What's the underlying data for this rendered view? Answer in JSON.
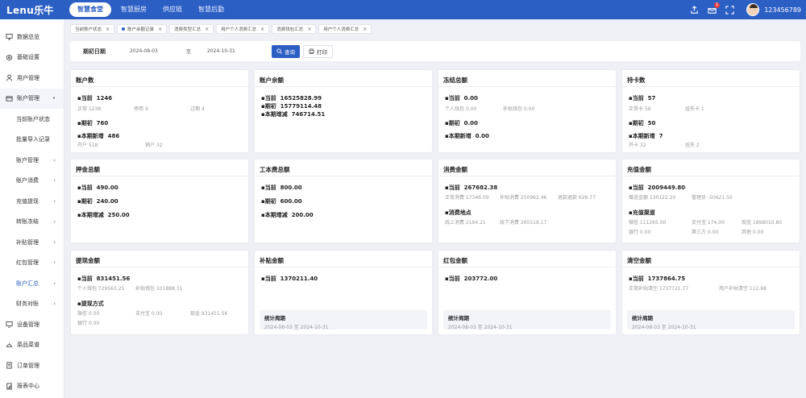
{
  "app": {
    "logo": "Lenu乐牛",
    "username": "123456789",
    "notification_count": "1"
  },
  "topnav": [
    "智慧食堂",
    "智慧厨房",
    "供应链",
    "智慧后勤"
  ],
  "sidebar": {
    "items": [
      {
        "label": "数据总览",
        "icon": "monitor-icon"
      },
      {
        "label": "基础设置",
        "icon": "settings-icon"
      },
      {
        "label": "用户管理",
        "icon": "user-icon"
      },
      {
        "label": "账户管理",
        "icon": "account-icon"
      }
    ],
    "subitems": [
      "当前账户状态",
      "批量导入记录",
      "账户管理",
      "账户消费",
      "充值提现",
      "转账冻结",
      "补贴管理",
      "红包管理",
      "账户汇总",
      "财务对账"
    ],
    "bottom": [
      {
        "label": "设备管理",
        "icon": "device-icon"
      },
      {
        "label": "菜品菜谱",
        "icon": "dish-icon"
      },
      {
        "label": "订单管理",
        "icon": "order-icon"
      },
      {
        "label": "报表中心",
        "icon": "report-icon"
      }
    ]
  },
  "tabs": [
    "当前账户状态",
    "账户余额记录",
    "消费类型汇总",
    "用户个人消费汇总",
    "消费钱包汇总",
    "用户个人消费汇总"
  ],
  "filter": {
    "label": "期初日期",
    "start": "2024-08-03",
    "sep": "至",
    "end": "2024-10-31",
    "query": "查询",
    "print": "打印"
  },
  "cards": {
    "c1": {
      "title": "账户数",
      "cur_l": "当前",
      "cur": "1246",
      "s1": "正常 1238",
      "s2": "停用 4",
      "s3": "过期 4",
      "beg_l": "期初",
      "beg": "760",
      "new_l": "本期新增",
      "new": "486",
      "n1": "开户 518",
      "n2": "销户 32"
    },
    "c2": {
      "title": "账户余额",
      "cur_l": "当前",
      "cur": "16525828.99",
      "beg_l": "期初",
      "beg": "15779114.48",
      "new_l": "本期增减",
      "new": "746714.51"
    },
    "c3": {
      "title": "冻结总额",
      "cur_l": "当前",
      "cur": "0.00",
      "s1": "个人钱包 0.00",
      "s2": "补贴钱包 0.00",
      "beg_l": "期初",
      "beg": "0.00",
      "new_l": "本期新增",
      "new": "0.00"
    },
    "c4": {
      "title": "持卡数",
      "cur_l": "当前",
      "cur": "57",
      "s1": "正常卡 56",
      "s2": "挂失卡 1",
      "beg_l": "期初",
      "beg": "50",
      "new_l": "本期新增",
      "new": "7",
      "n1": "开卡 32",
      "n2": "挂失 2"
    },
    "c5": {
      "title": "押金总额",
      "cur_l": "当前",
      "cur": "490.00",
      "beg_l": "期初",
      "beg": "240.00",
      "new_l": "本期增减",
      "new": "250.00"
    },
    "c6": {
      "title": "工本费总额",
      "cur_l": "当前",
      "cur": "800.00",
      "beg_l": "期初",
      "beg": "600.00",
      "new_l": "本期增减",
      "new": "200.00"
    },
    "c7": {
      "title": "消费金额",
      "cur_l": "当前",
      "cur": "267682.38",
      "s1": "正常消费 17346.09",
      "s2": "补贴消费 250962.46",
      "s3": "退款退款 626.77",
      "sub_title": "消费地点",
      "t1": "线上消费 2164.21",
      "t2": "线下消费 265518.17"
    },
    "c8": {
      "title": "充值金额",
      "cur_l": "当前",
      "cur": "2009449.80",
      "s1": "赠送金额 130122.20",
      "s2": "管理员 -50621.50",
      "sub_title": "充值渠道",
      "t1": "微信 111265.00",
      "t2": "支付宝 174.00",
      "t3": "现金 1898010.80",
      "t4": "银行 0.00",
      "t5": "第三方 0.00",
      "t6": "其他 0.00"
    },
    "c9": {
      "title": "提现金额",
      "cur_l": "当前",
      "cur": "831451.56",
      "s1": "个人钱包 729563.25",
      "s2": "补贴钱包 101888.31",
      "sub_title": "提现方式",
      "t1": "微信 0.00",
      "t2": "支付宝 0.00",
      "t3": "现金 831451.56",
      "t4": "银行 0.00"
    },
    "c10": {
      "title": "补贴金额",
      "cur_l": "当前",
      "cur": "1370211.40",
      "p_title": "统计周期",
      "p_val": "2024-08-03 至 2024-10-31"
    },
    "c11": {
      "title": "红包金额",
      "cur_l": "当前",
      "cur": "203772.00",
      "p_title": "统计周期",
      "p_val": "2024-08-03 至 2024-10-31"
    },
    "c12": {
      "title": "清空金额",
      "cur_l": "当前",
      "cur": "1737864.75",
      "s1": "正常补贴清空 1737721.77",
      "s2": "用户补贴清空 112.98",
      "p_title": "统计周期",
      "p_val": "2024-08-03 至 2024-10-31"
    }
  }
}
